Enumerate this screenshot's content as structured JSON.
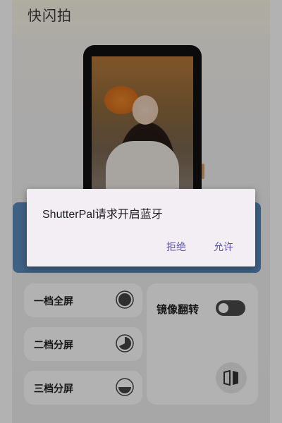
{
  "app": {
    "title": "快闪拍"
  },
  "modes": [
    {
      "label": "一档全屏",
      "icon": "full-circle-icon"
    },
    {
      "label": "二档分屏",
      "icon": "half-circle-icon"
    },
    {
      "label": "三档分屏",
      "icon": "quarter-circle-icon"
    }
  ],
  "mirror": {
    "label": "镜像翻转",
    "enabled": false,
    "icon": "mirror-flip-icon"
  },
  "dialog": {
    "message": "ShutterPal请求开启蓝牙",
    "deny_label": "拒绝",
    "allow_label": "允许"
  },
  "colors": {
    "dialog_accent": "#5a52a8",
    "bottom_bar": "#3f6184"
  }
}
